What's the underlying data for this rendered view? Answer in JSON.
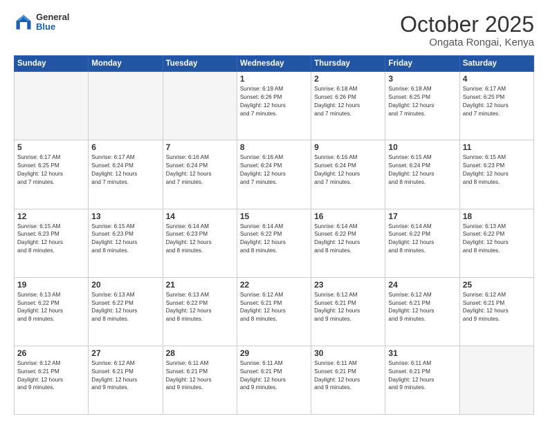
{
  "header": {
    "logo_general": "General",
    "logo_blue": "Blue",
    "month": "October 2025",
    "location": "Ongata Rongai, Kenya"
  },
  "weekdays": [
    "Sunday",
    "Monday",
    "Tuesday",
    "Wednesday",
    "Thursday",
    "Friday",
    "Saturday"
  ],
  "weeks": [
    [
      {
        "day": "",
        "info": ""
      },
      {
        "day": "",
        "info": ""
      },
      {
        "day": "",
        "info": ""
      },
      {
        "day": "1",
        "info": "Sunrise: 6:19 AM\nSunset: 6:26 PM\nDaylight: 12 hours\nand 7 minutes."
      },
      {
        "day": "2",
        "info": "Sunrise: 6:18 AM\nSunset: 6:26 PM\nDaylight: 12 hours\nand 7 minutes."
      },
      {
        "day": "3",
        "info": "Sunrise: 6:18 AM\nSunset: 6:25 PM\nDaylight: 12 hours\nand 7 minutes."
      },
      {
        "day": "4",
        "info": "Sunrise: 6:17 AM\nSunset: 6:25 PM\nDaylight: 12 hours\nand 7 minutes."
      }
    ],
    [
      {
        "day": "5",
        "info": "Sunrise: 6:17 AM\nSunset: 6:25 PM\nDaylight: 12 hours\nand 7 minutes."
      },
      {
        "day": "6",
        "info": "Sunrise: 6:17 AM\nSunset: 6:24 PM\nDaylight: 12 hours\nand 7 minutes."
      },
      {
        "day": "7",
        "info": "Sunrise: 6:16 AM\nSunset: 6:24 PM\nDaylight: 12 hours\nand 7 minutes."
      },
      {
        "day": "8",
        "info": "Sunrise: 6:16 AM\nSunset: 6:24 PM\nDaylight: 12 hours\nand 7 minutes."
      },
      {
        "day": "9",
        "info": "Sunrise: 6:16 AM\nSunset: 6:24 PM\nDaylight: 12 hours\nand 7 minutes."
      },
      {
        "day": "10",
        "info": "Sunrise: 6:15 AM\nSunset: 6:24 PM\nDaylight: 12 hours\nand 8 minutes."
      },
      {
        "day": "11",
        "info": "Sunrise: 6:15 AM\nSunset: 6:23 PM\nDaylight: 12 hours\nand 8 minutes."
      }
    ],
    [
      {
        "day": "12",
        "info": "Sunrise: 6:15 AM\nSunset: 6:23 PM\nDaylight: 12 hours\nand 8 minutes."
      },
      {
        "day": "13",
        "info": "Sunrise: 6:15 AM\nSunset: 6:23 PM\nDaylight: 12 hours\nand 8 minutes."
      },
      {
        "day": "14",
        "info": "Sunrise: 6:14 AM\nSunset: 6:23 PM\nDaylight: 12 hours\nand 8 minutes."
      },
      {
        "day": "15",
        "info": "Sunrise: 6:14 AM\nSunset: 6:22 PM\nDaylight: 12 hours\nand 8 minutes."
      },
      {
        "day": "16",
        "info": "Sunrise: 6:14 AM\nSunset: 6:22 PM\nDaylight: 12 hours\nand 8 minutes."
      },
      {
        "day": "17",
        "info": "Sunrise: 6:14 AM\nSunset: 6:22 PM\nDaylight: 12 hours\nand 8 minutes."
      },
      {
        "day": "18",
        "info": "Sunrise: 6:13 AM\nSunset: 6:22 PM\nDaylight: 12 hours\nand 8 minutes."
      }
    ],
    [
      {
        "day": "19",
        "info": "Sunrise: 6:13 AM\nSunset: 6:22 PM\nDaylight: 12 hours\nand 8 minutes."
      },
      {
        "day": "20",
        "info": "Sunrise: 6:13 AM\nSunset: 6:22 PM\nDaylight: 12 hours\nand 8 minutes."
      },
      {
        "day": "21",
        "info": "Sunrise: 6:13 AM\nSunset: 6:22 PM\nDaylight: 12 hours\nand 8 minutes."
      },
      {
        "day": "22",
        "info": "Sunrise: 6:12 AM\nSunset: 6:21 PM\nDaylight: 12 hours\nand 8 minutes."
      },
      {
        "day": "23",
        "info": "Sunrise: 6:12 AM\nSunset: 6:21 PM\nDaylight: 12 hours\nand 9 minutes."
      },
      {
        "day": "24",
        "info": "Sunrise: 6:12 AM\nSunset: 6:21 PM\nDaylight: 12 hours\nand 9 minutes."
      },
      {
        "day": "25",
        "info": "Sunrise: 6:12 AM\nSunset: 6:21 PM\nDaylight: 12 hours\nand 9 minutes."
      }
    ],
    [
      {
        "day": "26",
        "info": "Sunrise: 6:12 AM\nSunset: 6:21 PM\nDaylight: 12 hours\nand 9 minutes."
      },
      {
        "day": "27",
        "info": "Sunrise: 6:12 AM\nSunset: 6:21 PM\nDaylight: 12 hours\nand 9 minutes."
      },
      {
        "day": "28",
        "info": "Sunrise: 6:11 AM\nSunset: 6:21 PM\nDaylight: 12 hours\nand 9 minutes."
      },
      {
        "day": "29",
        "info": "Sunrise: 6:11 AM\nSunset: 6:21 PM\nDaylight: 12 hours\nand 9 minutes."
      },
      {
        "day": "30",
        "info": "Sunrise: 6:11 AM\nSunset: 6:21 PM\nDaylight: 12 hours\nand 9 minutes."
      },
      {
        "day": "31",
        "info": "Sunrise: 6:11 AM\nSunset: 6:21 PM\nDaylight: 12 hours\nand 9 minutes."
      },
      {
        "day": "",
        "info": ""
      }
    ]
  ]
}
